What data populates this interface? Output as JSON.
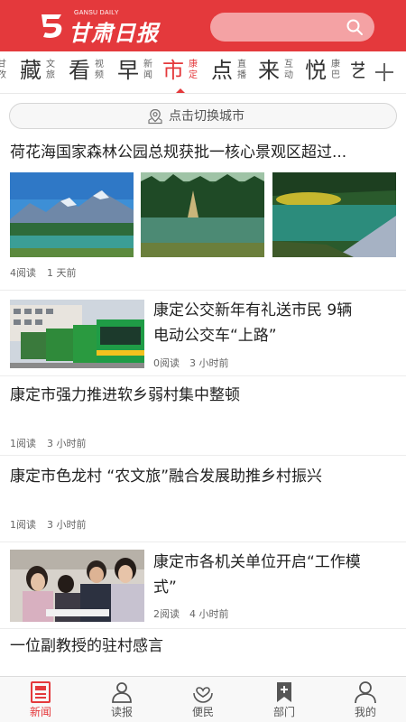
{
  "brand": {
    "logo_text": "甘肃日报",
    "logo_small": "GANSU DAILY",
    "accent": "#e4393c"
  },
  "search": {
    "icon": "search-icon"
  },
  "channels": [
    {
      "big": "",
      "small": "甘孜"
    },
    {
      "big": "藏",
      "small": "文旅"
    },
    {
      "big": "看",
      "small": "视频"
    },
    {
      "big": "早",
      "small": "新闻"
    },
    {
      "big": "市",
      "small": "康定"
    },
    {
      "big": "点",
      "small": "直播"
    },
    {
      "big": "来",
      "small": "互动"
    },
    {
      "big": "悦",
      "small": "康巴"
    },
    {
      "big": "艺",
      "small": ""
    }
  ],
  "active_channel": "市",
  "city_switch": {
    "label": "点击切换城市",
    "icon": "location-pin-icon"
  },
  "news": [
    {
      "title": "荷花海国家森林公园总规获批一核心景观区超过...",
      "reads": "4阅读",
      "time": "1 天前"
    },
    {
      "title_line1": "康定公交新年有礼送市民 9辆",
      "title_line2": "电动公交车“上路”",
      "reads": "0阅读",
      "time": "3 小时前"
    },
    {
      "title": "康定市强力推进软乡弱村集中整顿",
      "reads": "1阅读",
      "time": "3 小时前"
    },
    {
      "title": "康定市色龙村 “农文旅”融合发展助推乡村振兴",
      "reads": "1阅读",
      "time": "3 小时前"
    },
    {
      "title_line1": "康定市各机关单位开启“工作模",
      "title_line2": "式”",
      "reads": "2阅读",
      "time": "4 小时前"
    },
    {
      "title": "一位副教授的驻村感言"
    }
  ],
  "tabs": [
    {
      "label": "新闻",
      "icon": "newspaper-icon",
      "active": true
    },
    {
      "label": "读报",
      "icon": "reader-icon"
    },
    {
      "label": "便民",
      "icon": "service-heart-icon"
    },
    {
      "label": "部门",
      "icon": "department-bookmark-icon"
    },
    {
      "label": "我的",
      "icon": "profile-icon"
    }
  ]
}
